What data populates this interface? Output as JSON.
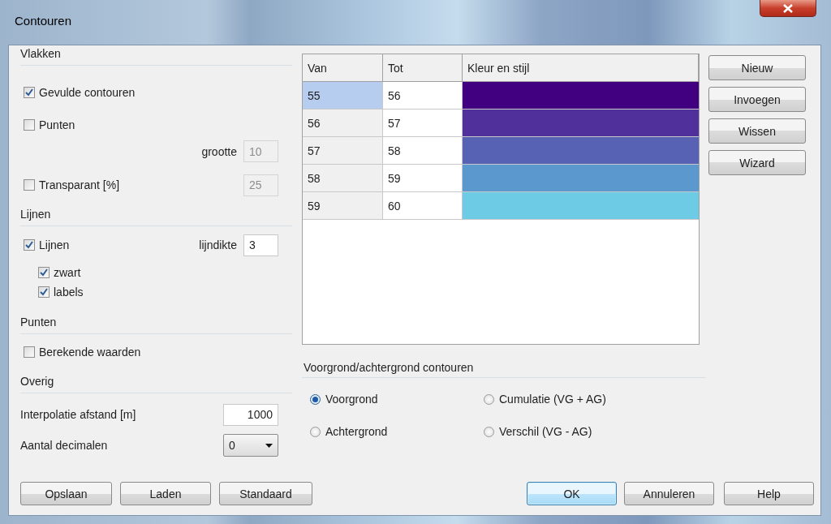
{
  "window": {
    "title": "Contouren"
  },
  "surfaces": {
    "heading": "Vlakken",
    "filled_contours": {
      "label": "Gevulde contouren",
      "checked": true
    },
    "points": {
      "label": "Punten",
      "checked": false
    },
    "size": {
      "label": "grootte",
      "value": "10",
      "disabled": true
    },
    "transparent": {
      "label": "Transparant [%]",
      "checked": false
    },
    "transparency": {
      "value": "25",
      "disabled": true
    }
  },
  "lines": {
    "heading": "Lijnen",
    "lines": {
      "label": "Lijnen",
      "checked": true,
      "children": [
        {
          "label": "zwart",
          "checked": true
        },
        {
          "label": "labels",
          "checked": true
        }
      ]
    },
    "line_width": {
      "label": "lijndikte",
      "value": "3"
    }
  },
  "points": {
    "heading": "Punten",
    "computed_values": {
      "label": "Berekende waarden",
      "checked": false
    }
  },
  "other": {
    "heading": "Overig",
    "interpolation": {
      "label": "Interpolatie afstand [m]",
      "value": "1000"
    },
    "decimals": {
      "label": "Aantal decimalen",
      "value": "0"
    }
  },
  "table": {
    "columns": [
      "Van",
      "Tot",
      "Kleur en stijl"
    ],
    "rows": [
      {
        "from": "55",
        "to": "56",
        "color": "#41007f",
        "selected": true
      },
      {
        "from": "56",
        "to": "57",
        "color": "#50309a",
        "selected": false
      },
      {
        "from": "57",
        "to": "58",
        "color": "#5762b4",
        "selected": false
      },
      {
        "from": "58",
        "to": "59",
        "color": "#5b98cd",
        "selected": false
      },
      {
        "from": "59",
        "to": "60",
        "color": "#6ecbe6",
        "selected": false
      }
    ]
  },
  "side_buttons": [
    "Nieuw",
    "Invoegen",
    "Wissen",
    "Wizard"
  ],
  "layer": {
    "heading": "Voorgrond/achtergrond contouren",
    "options": [
      {
        "label": "Voorgrond",
        "selected": true
      },
      {
        "label": "Achtergrond",
        "selected": false
      },
      {
        "label": "Cumulatie (VG + AG)",
        "selected": false
      },
      {
        "label": "Verschil (VG - AG)",
        "selected": false
      }
    ]
  },
  "footer_left": [
    "Opslaan",
    "Laden",
    "Standaard"
  ],
  "footer_right": [
    {
      "label": "OK",
      "default": true
    },
    {
      "label": "Annuleren",
      "default": false
    },
    {
      "label": "Help",
      "default": false
    }
  ]
}
